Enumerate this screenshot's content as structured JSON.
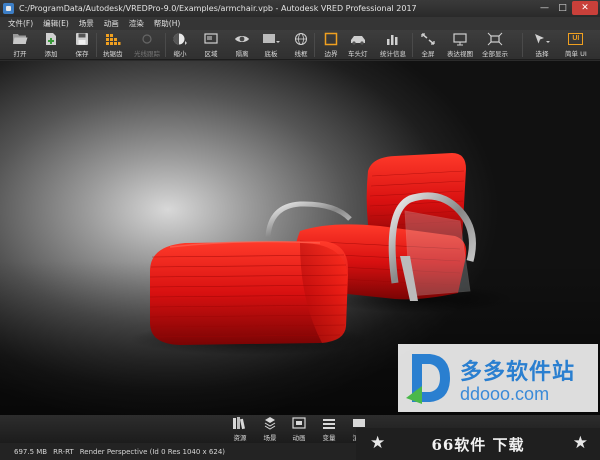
{
  "window": {
    "title": "C:/ProgramData/Autodesk/VREDPro-9.0/Examples/armchair.vpb - Autodesk VRED Professional 2017",
    "minimize": "—",
    "maximize": "□",
    "close": "✕"
  },
  "menu": [
    "文件(F)",
    "编辑(E)",
    "场景",
    "动画",
    "渲染",
    "帮助(H)"
  ],
  "toolbar": {
    "open": "打开",
    "add": "添加",
    "save": "保存",
    "antialias": "抗锯齿",
    "raytrace": "光线跟踪",
    "zoom_out": "缩小",
    "region": "区域",
    "isolate": "隔离",
    "backplate": "底板",
    "wireframe": "线框",
    "bounds": "边界",
    "headlight": "车头灯",
    "statistics": "统计信息",
    "fullscreen": "全屏",
    "presentation": "表达视图",
    "show_all": "全部显示",
    "select": "选择",
    "simple_ui": "简单 UI",
    "ui_badge": "UI"
  },
  "dock": {
    "assets": "资源",
    "scene": "场景",
    "animation": "动画",
    "variants": "变量",
    "render": "渲染"
  },
  "status": {
    "memory": "697.5 MB",
    "mode": "RR-RT",
    "render_info": "Render Perspective (Id 0 Res 1040 x 624)"
  },
  "watermark": {
    "name": "多多软件站",
    "domain": "ddooo.com"
  },
  "banner": {
    "text": "66软件 下载",
    "star": "★"
  },
  "colors": {
    "accent_orange": "#f0a020",
    "chair_red": "#e01818",
    "watermark_blue": "#2a7fd0"
  }
}
